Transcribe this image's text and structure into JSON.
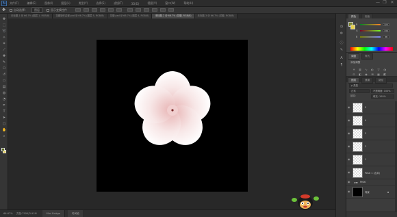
{
  "app": {
    "brand_icon": "photoshop-ps-icon",
    "menu": [
      "文件(F)",
      "编辑(E)",
      "图像(I)",
      "图层(L)",
      "类型(Y)",
      "选择(S)",
      "滤镜(T)",
      "3D(D)",
      "视图(V)",
      "窗口(W)",
      "帮助(H)"
    ],
    "window_controls": [
      "—",
      "❐",
      "✕"
    ]
  },
  "options_bar": {
    "tool_icon": "move-tool-icon",
    "auto_select_label": "自动选择：",
    "auto_select_value": "图层",
    "show_transform_label": "显示变换控件"
  },
  "tabs": [
    {
      "label": "未标题-1 @ 66.7% (图层 1, RGB/8)",
      "active": false
    },
    {
      "label": "花瓣制作过程.psd @ 66.7% (图层 5, RGB/8)",
      "active": false
    },
    {
      "label": "花瓣.psd @ 66.7% (图层 4, RGB/8)",
      "active": false
    },
    {
      "label": "未标题-2 @ 66.7% (花瓣, RGB/8)",
      "active": true
    },
    {
      "label": "未标题-3 @ 66.7% (花瓣, RGB/8)",
      "active": false
    }
  ],
  "tools": [
    "move-tool-icon",
    "marquee-tool-icon",
    "lasso-tool-icon",
    "quick-select-tool-icon",
    "crop-tool-icon",
    "eyedropper-tool-icon",
    "healing-brush-icon",
    "brush-tool-icon",
    "clone-stamp-icon",
    "history-brush-icon",
    "eraser-icon",
    "gradient-tool-icon",
    "blur-tool-icon",
    "dodge-tool-icon",
    "pen-tool-icon",
    "type-tool-icon",
    "path-select-icon",
    "shape-tool-icon",
    "hand-tool-icon",
    "zoom-tool-icon"
  ],
  "canvas": {
    "background_color": "#000000",
    "flower_color": "#f4dada",
    "center_color": "#7a2a2a"
  },
  "status": {
    "zoom": "66.67%",
    "doc_info": "文档:750K/3.91M",
    "bottom_tabs": [
      "Mini Bridge",
      "时间轴"
    ]
  },
  "color_panel": {
    "tabs": [
      "颜色",
      "色板"
    ],
    "sliders": [
      {
        "label": "R",
        "value": "122"
      },
      {
        "label": "G",
        "value": "130"
      },
      {
        "label": "B",
        "value": "38"
      }
    ],
    "foreground_color": "#7a8226"
  },
  "adjustments_panel": {
    "tabs": [
      "调整",
      "样式"
    ],
    "heading": "添加调整",
    "icons": [
      "brightness-icon",
      "levels-icon",
      "curves-icon",
      "exposure-icon",
      "vibrance-icon",
      "hue-sat-icon",
      "color-balance-icon",
      "bw-icon",
      "photo-filter-icon",
      "channel-mixer-icon",
      "color-lookup-icon",
      "invert-icon"
    ]
  },
  "layers_panel": {
    "tabs": [
      "图层",
      "通道",
      "路径"
    ],
    "filter_label": "ρ 类型",
    "blend_mode": "正常",
    "opacity_label": "不透明度: 100%",
    "lock_label": "锁定:",
    "fill_label": "填充: 100%",
    "layers": [
      {
        "name": "5",
        "thumb": "checker"
      },
      {
        "name": "4",
        "thumb": "checker"
      },
      {
        "name": "3",
        "thumb": "checker"
      },
      {
        "name": "2",
        "thumb": "checker"
      },
      {
        "name": "1",
        "thumb": "checker"
      },
      {
        "name": "Petal 1 (合并)",
        "thumb": "checker"
      }
    ],
    "group_name": "Petal",
    "background_layer": "背景"
  },
  "overlay": {
    "mascot_icon": "cartoon-mascot-icon"
  }
}
